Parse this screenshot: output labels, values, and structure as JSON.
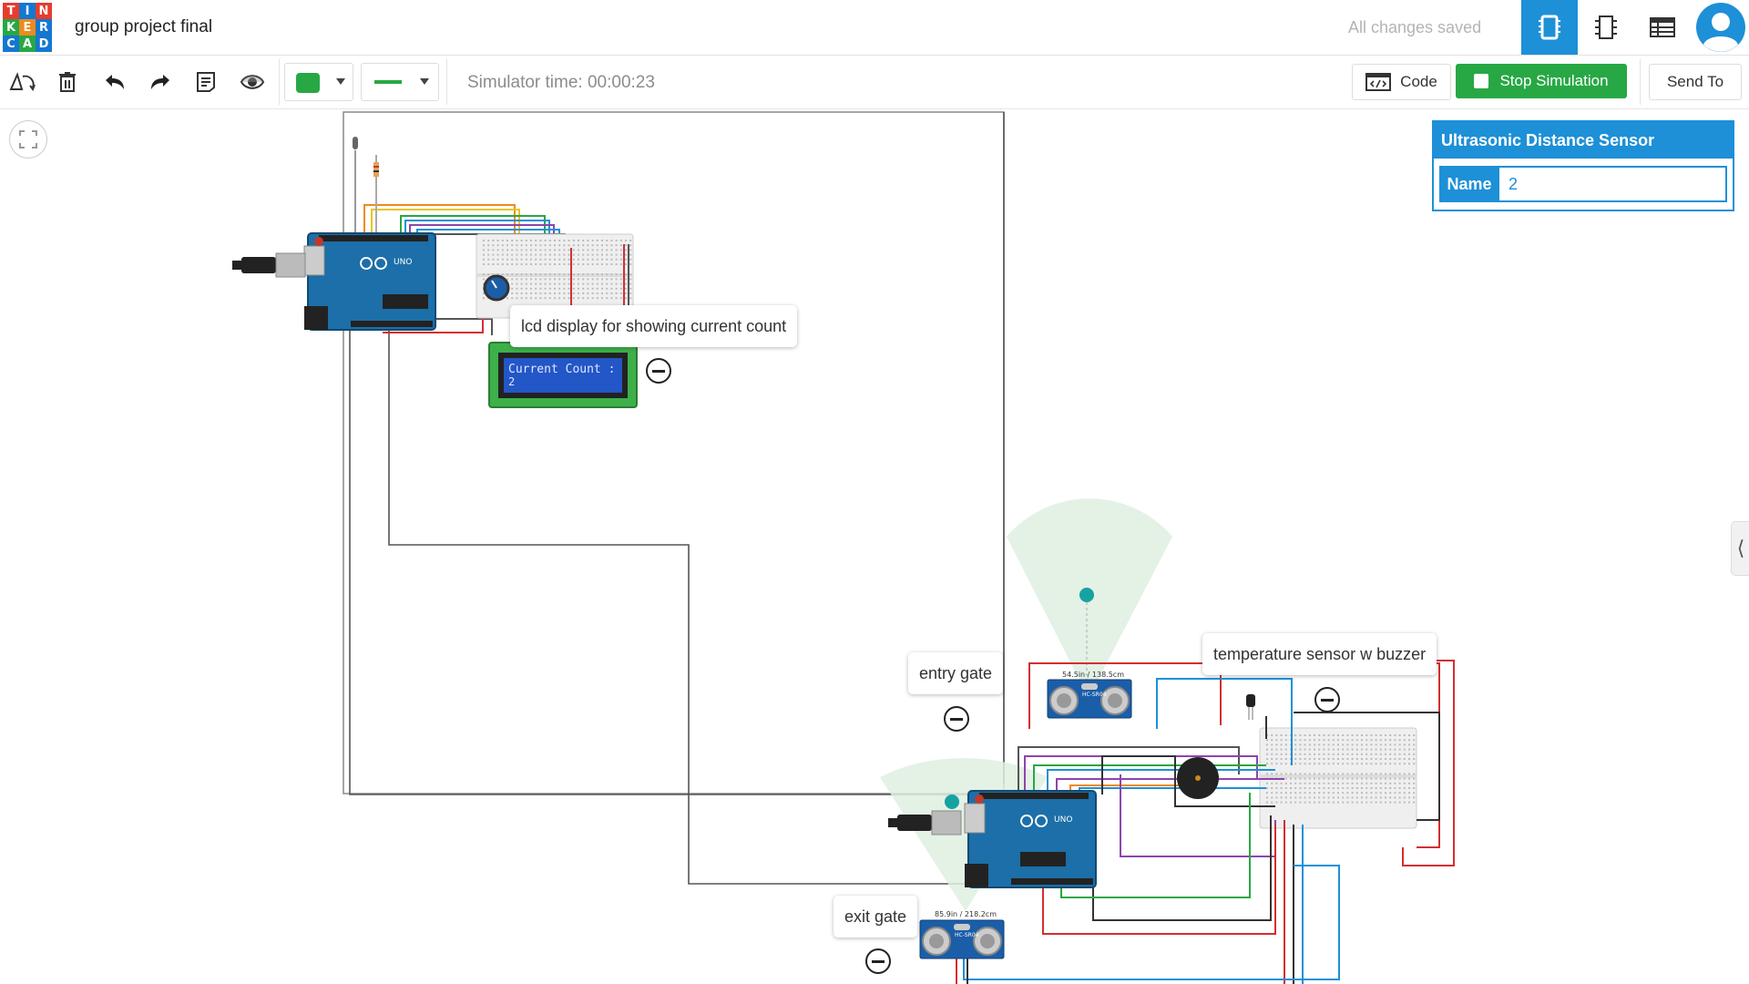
{
  "app": {
    "logo_letters": [
      "T",
      "I",
      "N",
      "K",
      "E",
      "R",
      "C",
      "A",
      "D"
    ],
    "logo_colors": [
      "#e53d2e",
      "#1477d1",
      "#e53d2e",
      "#27a844",
      "#ee8a1f",
      "#1477d1",
      "#1477d1",
      "#27a844",
      "#1477d1"
    ],
    "project_title": "group project final",
    "save_status": "All changes saved"
  },
  "top_icons": [
    "circuit-view-icon",
    "schematic-view-icon",
    "component-list-icon",
    "user-avatar-icon"
  ],
  "toolbar": {
    "icons": [
      "rotate-icon",
      "delete-icon",
      "undo-icon",
      "redo-icon",
      "notes-icon",
      "visibility-icon"
    ],
    "wire_color": "#27a844",
    "simulator_time": "Simulator time: 00:00:23",
    "code_label": "Code",
    "stop_label": "Stop Simulation",
    "send_label": "Send To"
  },
  "inspector": {
    "title": "Ultrasonic Distance Sensor",
    "name_label": "Name",
    "name_value": "2"
  },
  "notes": {
    "lcd": "lcd display for showing current count",
    "entry": "entry gate",
    "exit": "exit gate",
    "temp": "temperature sensor w buzzer"
  },
  "circuit": {
    "lcd_line1": "Current Count :",
    "lcd_line2": "2",
    "board_label": "UNO",
    "sensor1_reading": "54.5in / 138.5cm",
    "sensor2_reading": "85.9in / 218.2cm",
    "sensor_model": "HC-SR04"
  }
}
